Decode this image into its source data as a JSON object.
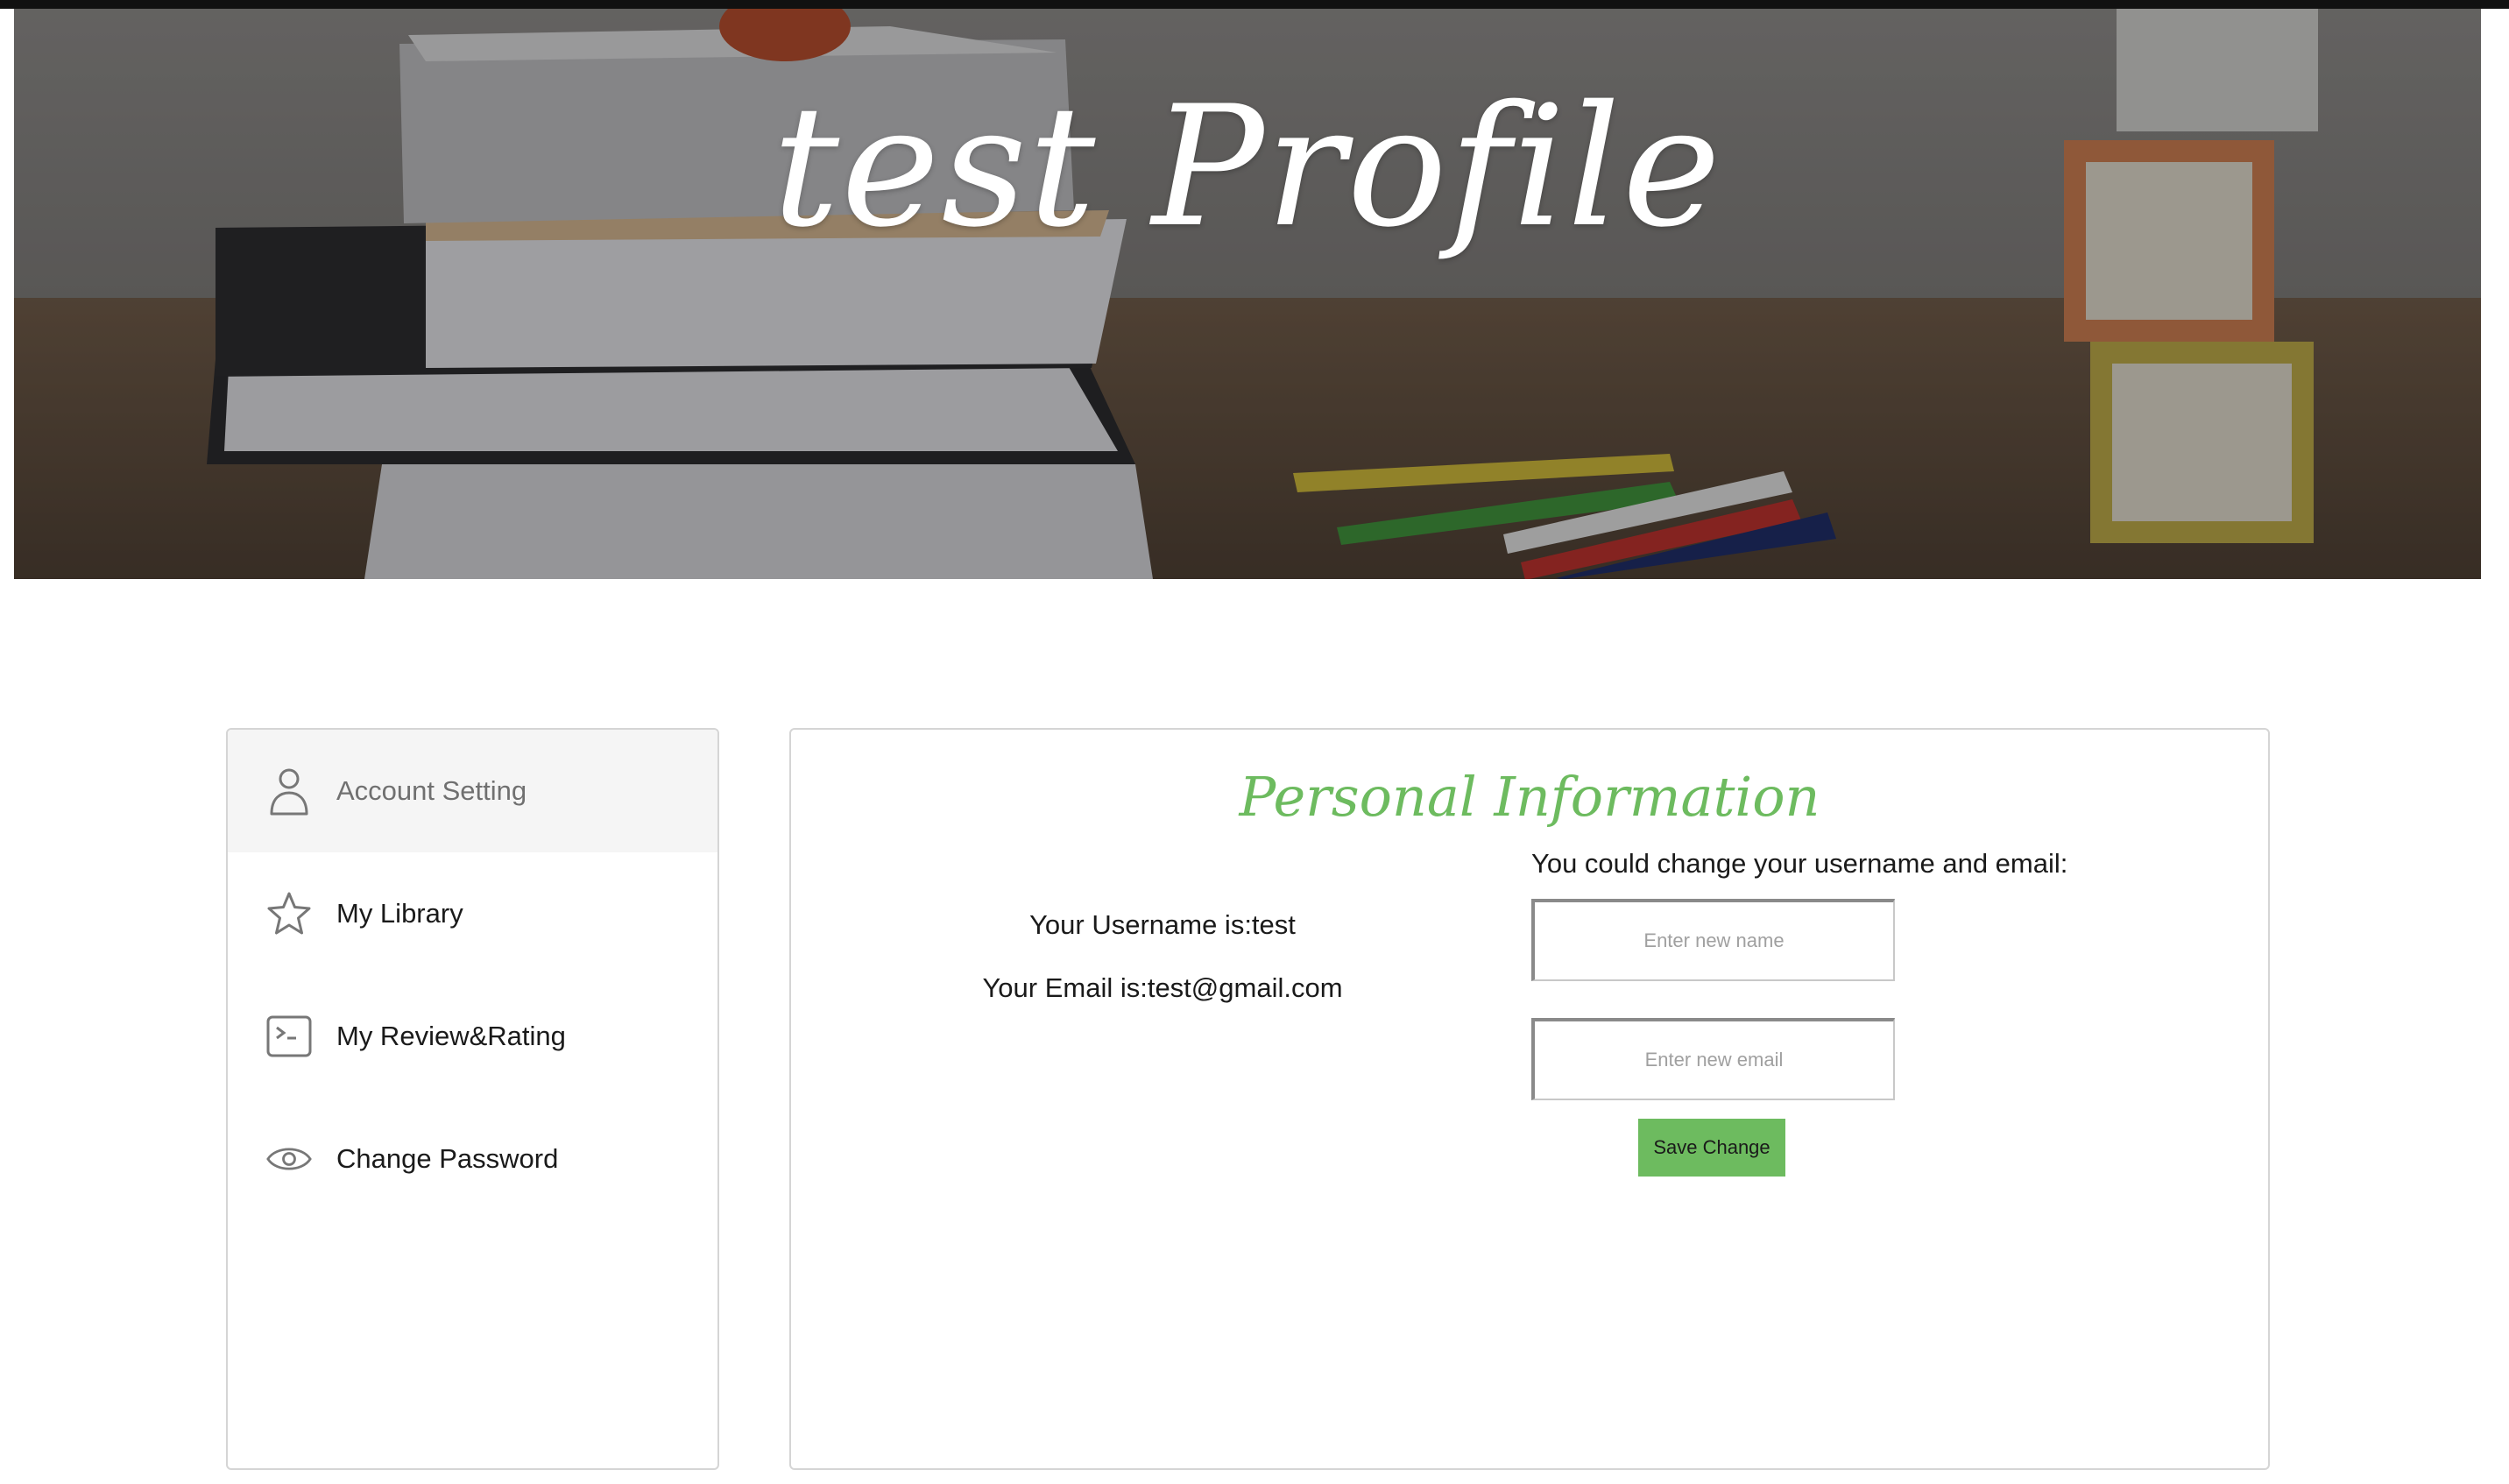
{
  "hero": {
    "title": "test Profile"
  },
  "sidebar": {
    "items": [
      {
        "label": "Account Setting",
        "icon": "user-icon",
        "active": true
      },
      {
        "label": "My Library",
        "icon": "star-icon",
        "active": false
      },
      {
        "label": "My Review&Rating",
        "icon": "terminal-icon",
        "active": false
      },
      {
        "label": "Change Password",
        "icon": "eye-icon",
        "active": false
      }
    ]
  },
  "panel": {
    "title": "Personal Information",
    "username_line": "Your Username is:test",
    "email_line": "Your Email is:test@gmail.com",
    "change_hint": "You could change your username and email:",
    "name_input": {
      "value": "",
      "placeholder": "Enter new name"
    },
    "email_input": {
      "value": "",
      "placeholder": "Enter new email"
    },
    "save_label": "Save Change"
  },
  "colors": {
    "accent_green": "#6dbb5f",
    "border": "#d5d5d5",
    "active_bg": "#f5f5f5"
  }
}
